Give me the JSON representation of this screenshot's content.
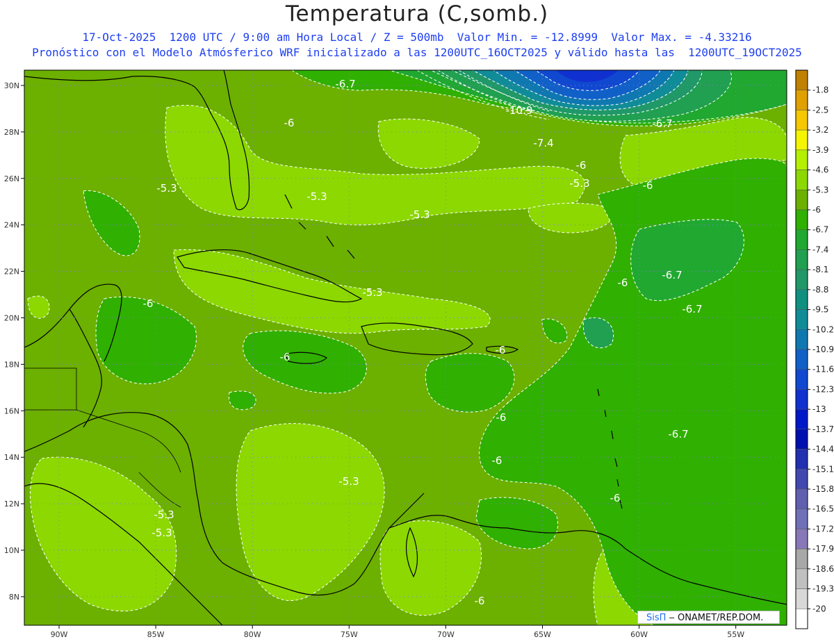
{
  "header": {
    "title": "Temperatura (C,somb.)",
    "subtitle_line1": "17-Oct-2025  1200 UTC / 9:00 am Hora Local / Z = 500mb  Valor Min. = -12.8999  Valor Max. = -4.33216",
    "subtitle_line2": "Pronóstico con el Modelo Atmósferico WRF inicializado a las 1200UTC_16OCT2025 y válido hasta las  1200UTC_19OCT2025"
  },
  "axes": {
    "lon_labels": [
      "90W",
      "85W",
      "80W",
      "75W",
      "70W",
      "65W",
      "60W",
      "55W"
    ],
    "lat_labels": [
      "30N",
      "28N",
      "26N",
      "24N",
      "22N",
      "20N",
      "18N",
      "16N",
      "14N",
      "12N",
      "10N",
      "8N"
    ]
  },
  "contour_labels": [
    "-6.7",
    "-10.9",
    "-6",
    "-6.7",
    "-7.4",
    "-6",
    "-5.3",
    "-6",
    "-5.3",
    "-5.3",
    "-5.3",
    "-6",
    "-6.7",
    "-6",
    "-6.7",
    "-5.3",
    "-6",
    "-6",
    "-6",
    "-6",
    "-6.7",
    "-6",
    "-5.3",
    "-6",
    "-5.3",
    "-5.3",
    "-6"
  ],
  "colorbar": {
    "labels": [
      "-1.8",
      "-2.5",
      "-3.2",
      "-3.9",
      "-4.6",
      "-5.3",
      "-6",
      "-6.7",
      "-7.4",
      "-8.1",
      "-8.8",
      "-9.5",
      "-10.2",
      "-10.9",
      "-11.6",
      "-12.3",
      "-13",
      "-13.7",
      "-14.4",
      "-15.1",
      "-15.8",
      "-16.5",
      "-17.2",
      "-17.9",
      "-18.6",
      "-19.3",
      "-20"
    ],
    "colors": [
      "#c08000",
      "#e0a000",
      "#f5c800",
      "#f5f500",
      "#b4f000",
      "#8cd800",
      "#6cb000",
      "#30b000",
      "#20a830",
      "#20a050",
      "#209868",
      "#109080",
      "#108c98",
      "#1078b0",
      "#1060c8",
      "#1048d0",
      "#1030d0",
      "#0018c8",
      "#0010b0",
      "#2030b0",
      "#4048b0",
      "#6060b0",
      "#7070b8",
      "#8878b8",
      "#a8a8a8",
      "#c0c0c0",
      "#d8d8d8",
      "#ffffff"
    ]
  },
  "credit": {
    "logo": "SisΠ",
    "text": " ‒  ONAMET/REP.DOM."
  }
}
